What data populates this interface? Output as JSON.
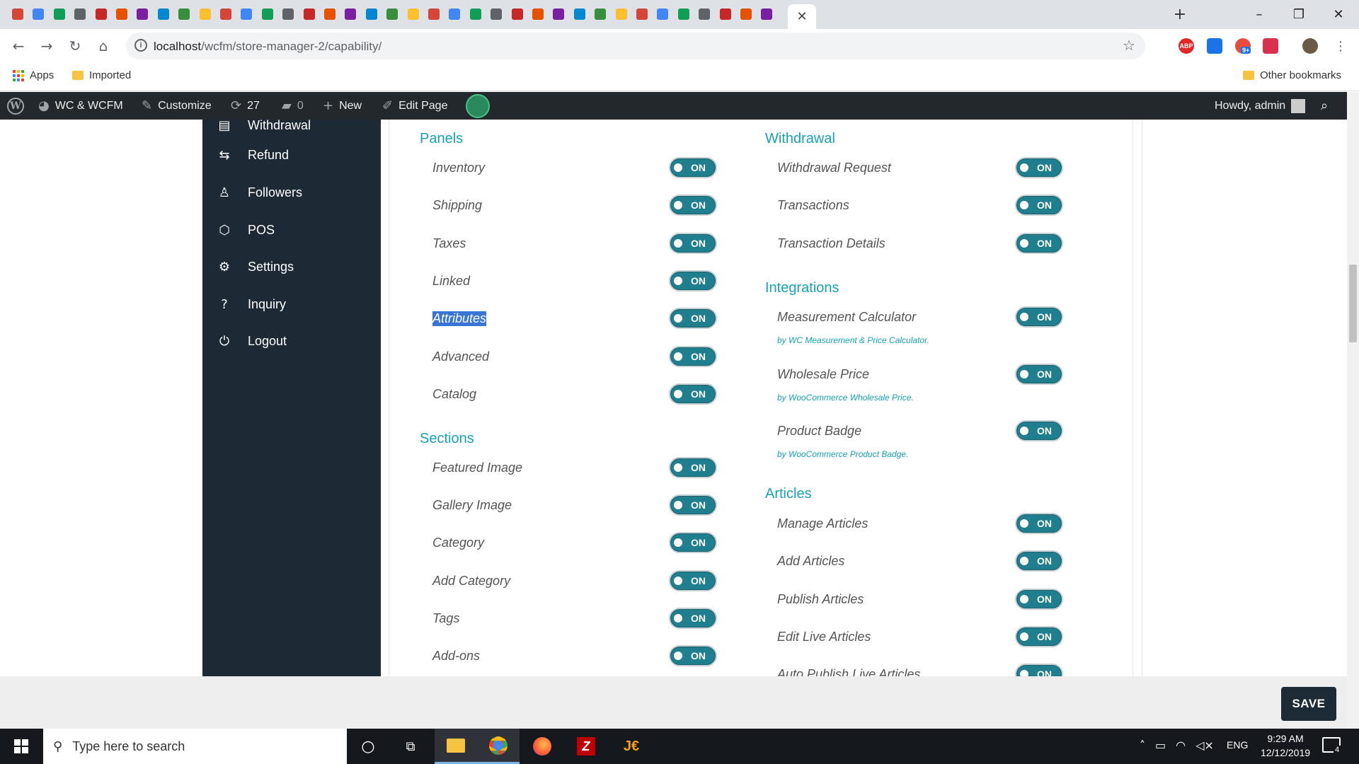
{
  "browser": {
    "url_host": "localhost",
    "url_path": "/wcfm/store-manager-2/capability/",
    "bookmarks": {
      "apps": "Apps",
      "imported": "Imported",
      "other": "Other bookmarks"
    },
    "ext_abp": "ABP",
    "ext_badge": "9+"
  },
  "adminbar": {
    "site": "WC & WCFM",
    "customize": "Customize",
    "updates": "27",
    "comments": "0",
    "new": "New",
    "edit_page": "Edit Page",
    "howdy": "Howdy, admin"
  },
  "sidebar": {
    "items": [
      {
        "label": "Withdrawal",
        "icon": "withdrawal-icon"
      },
      {
        "label": "Refund",
        "icon": "refund-icon"
      },
      {
        "label": "Followers",
        "icon": "followers-icon"
      },
      {
        "label": "POS",
        "icon": "pos-icon"
      },
      {
        "label": "Settings",
        "icon": "settings-icon"
      },
      {
        "label": "Inquiry",
        "icon": "inquiry-icon"
      },
      {
        "label": "Logout",
        "icon": "logout-icon"
      }
    ]
  },
  "toggle_label": "ON",
  "left": {
    "panels_title": "Panels",
    "panels": [
      "Inventory",
      "Shipping",
      "Taxes",
      "Linked",
      "Attributes",
      "Advanced",
      "Catalog"
    ],
    "sections_title": "Sections",
    "sections": [
      "Featured Image",
      "Gallery Image",
      "Category",
      "Add Category",
      "Tags",
      "Add-ons"
    ]
  },
  "right": {
    "withdrawal_title": "Withdrawal",
    "withdrawal": [
      "Withdrawal Request",
      "Transactions",
      "Transaction Details"
    ],
    "integrations_title": "Integrations",
    "integrations": [
      {
        "label": "Measurement Calculator",
        "note": "by WC Measurement & Price Calculator."
      },
      {
        "label": "Wholesale Price",
        "note": "by WooCommerce Wholesale Price."
      },
      {
        "label": "Product Badge",
        "note": "by WooCommerce Product Badge."
      }
    ],
    "articles_title": "Articles",
    "articles": [
      "Manage Articles",
      "Add Articles",
      "Publish Articles",
      "Edit Live Articles",
      "Auto Publish Live Articles"
    ]
  },
  "save_label": "SAVE",
  "taskbar": {
    "search_placeholder": "Type here to search",
    "lang": "ENG",
    "time": "9:29 AM",
    "date": "12/12/2019",
    "notif_count": "4"
  },
  "colors": {
    "accent": "#17a2b8",
    "sidebar": "#1d2a35",
    "toggle": "#1f7f8e",
    "adminbar": "#23282d"
  }
}
